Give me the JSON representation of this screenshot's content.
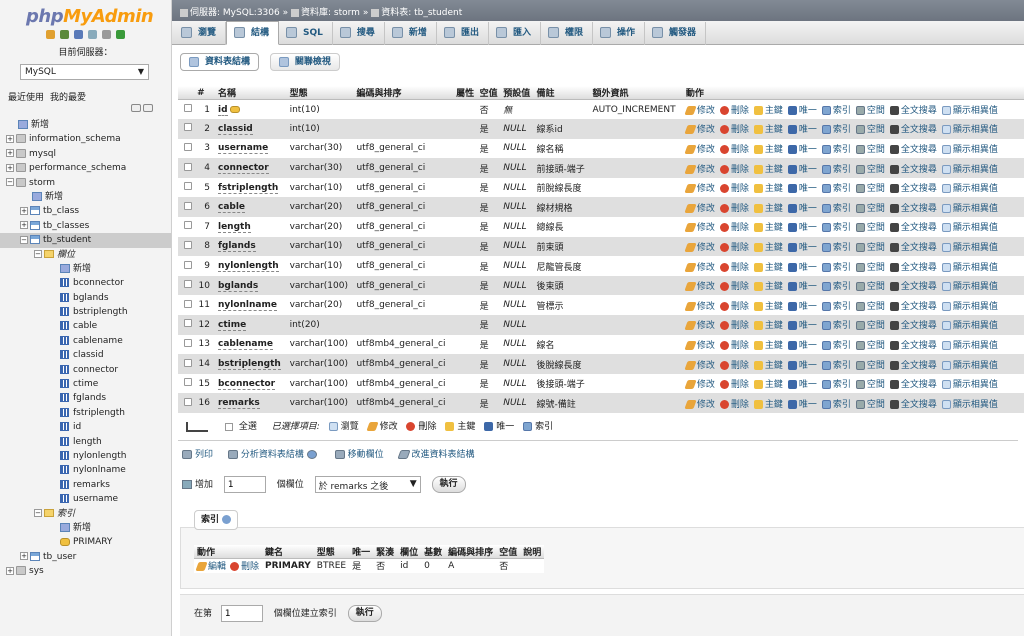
{
  "left": {
    "logo_part1": "php",
    "logo_part2": "MyAdmin",
    "server_label": "目前伺服器：",
    "server_value": "MySQL",
    "recent": "最近使用",
    "favorites": "我的最愛",
    "tree": [
      {
        "label": "新增",
        "kind": "new",
        "indent": 0
      },
      {
        "label": "information_schema",
        "kind": "db",
        "indent": 0
      },
      {
        "label": "mysql",
        "kind": "db",
        "indent": 0
      },
      {
        "label": "performance_schema",
        "kind": "db",
        "indent": 0
      },
      {
        "label": "storm",
        "kind": "db",
        "indent": 0,
        "expanded": true
      },
      {
        "label": "新增",
        "kind": "new",
        "indent": 1
      },
      {
        "label": "tb_class",
        "kind": "table",
        "indent": 1
      },
      {
        "label": "tb_classes",
        "kind": "table",
        "indent": 1
      },
      {
        "label": "tb_student",
        "kind": "table",
        "indent": 1,
        "expanded": true,
        "selected": true
      },
      {
        "label": "欄位",
        "kind": "folder",
        "indent": 2,
        "italic": true
      },
      {
        "label": "新增",
        "kind": "new",
        "indent": 3
      },
      {
        "label": "bconnector",
        "kind": "col",
        "indent": 3
      },
      {
        "label": "bglands",
        "kind": "col",
        "indent": 3
      },
      {
        "label": "bstriplength",
        "kind": "col",
        "indent": 3
      },
      {
        "label": "cable",
        "kind": "col",
        "indent": 3
      },
      {
        "label": "cablename",
        "kind": "col",
        "indent": 3
      },
      {
        "label": "classid",
        "kind": "col",
        "indent": 3
      },
      {
        "label": "connector",
        "kind": "col",
        "indent": 3
      },
      {
        "label": "ctime",
        "kind": "col",
        "indent": 3
      },
      {
        "label": "fglands",
        "kind": "col",
        "indent": 3
      },
      {
        "label": "fstriplength",
        "kind": "col",
        "indent": 3
      },
      {
        "label": "id",
        "kind": "col",
        "indent": 3
      },
      {
        "label": "length",
        "kind": "col",
        "indent": 3
      },
      {
        "label": "nylonlength",
        "kind": "col",
        "indent": 3
      },
      {
        "label": "nylonlname",
        "kind": "col",
        "indent": 3
      },
      {
        "label": "remarks",
        "kind": "col",
        "indent": 3
      },
      {
        "label": "username",
        "kind": "col",
        "indent": 3
      },
      {
        "label": "索引",
        "kind": "folder",
        "indent": 2,
        "italic": true
      },
      {
        "label": "新增",
        "kind": "new",
        "indent": 3
      },
      {
        "label": "PRIMARY",
        "kind": "key",
        "indent": 3
      },
      {
        "label": "tb_user",
        "kind": "table",
        "indent": 1
      },
      {
        "label": "sys",
        "kind": "db",
        "indent": 0
      }
    ]
  },
  "breadcrumb": {
    "server": "伺服器: MySQL:3306",
    "sep": "»",
    "database": "資料庫: storm",
    "table": "資料表: tb_student"
  },
  "tabs": [
    "瀏覽",
    "結構",
    "SQL",
    "搜尋",
    "新增",
    "匯出",
    "匯入",
    "權限",
    "操作",
    "觸發器"
  ],
  "active_tab": 1,
  "subtabs": [
    "資料表結構",
    "關聯檢視"
  ],
  "columns_header": [
    "#",
    "名稱",
    "型態",
    "編碼與排序",
    "屬性",
    "空值",
    "預設值",
    "備註",
    "額外資訊",
    "動作"
  ],
  "rows": [
    {
      "n": "1",
      "name": "id",
      "pk": true,
      "type": "int(10)",
      "coll": "",
      "nul": "否",
      "def": "無",
      "def_italic": true,
      "comment": "",
      "extra": "AUTO_INCREMENT"
    },
    {
      "n": "2",
      "name": "classid",
      "type": "int(10)",
      "coll": "",
      "nul": "是",
      "def": "NULL",
      "def_italic": true,
      "comment": "線系id",
      "extra": ""
    },
    {
      "n": "3",
      "name": "username",
      "type": "varchar(30)",
      "coll": "utf8_general_ci",
      "nul": "是",
      "def": "NULL",
      "def_italic": true,
      "comment": "線名稱",
      "extra": ""
    },
    {
      "n": "4",
      "name": "connector",
      "type": "varchar(30)",
      "coll": "utf8_general_ci",
      "nul": "是",
      "def": "NULL",
      "def_italic": true,
      "comment": "前接頭-端子",
      "extra": ""
    },
    {
      "n": "5",
      "name": "fstriplength",
      "type": "varchar(10)",
      "coll": "utf8_general_ci",
      "nul": "是",
      "def": "NULL",
      "def_italic": true,
      "comment": "前脫線長度",
      "extra": ""
    },
    {
      "n": "6",
      "name": "cable",
      "type": "varchar(20)",
      "coll": "utf8_general_ci",
      "nul": "是",
      "def": "NULL",
      "def_italic": true,
      "comment": "線材規格",
      "extra": ""
    },
    {
      "n": "7",
      "name": "length",
      "type": "varchar(20)",
      "coll": "utf8_general_ci",
      "nul": "是",
      "def": "NULL",
      "def_italic": true,
      "comment": "總線長",
      "extra": ""
    },
    {
      "n": "8",
      "name": "fglands",
      "type": "varchar(10)",
      "coll": "utf8_general_ci",
      "nul": "是",
      "def": "NULL",
      "def_italic": true,
      "comment": "前束頭",
      "extra": ""
    },
    {
      "n": "9",
      "name": "nylonlength",
      "type": "varchar(10)",
      "coll": "utf8_general_ci",
      "nul": "是",
      "def": "NULL",
      "def_italic": true,
      "comment": "尼龍管長度",
      "extra": ""
    },
    {
      "n": "10",
      "name": "bglands",
      "type": "varchar(100)",
      "coll": "utf8_general_ci",
      "nul": "是",
      "def": "NULL",
      "def_italic": true,
      "comment": "後束頭",
      "extra": ""
    },
    {
      "n": "11",
      "name": "nylonlname",
      "type": "varchar(20)",
      "coll": "utf8_general_ci",
      "nul": "是",
      "def": "NULL",
      "def_italic": true,
      "comment": "管標示",
      "extra": ""
    },
    {
      "n": "12",
      "name": "ctime",
      "type": "int(20)",
      "coll": "",
      "nul": "是",
      "def": "NULL",
      "def_italic": true,
      "comment": "",
      "extra": ""
    },
    {
      "n": "13",
      "name": "cablename",
      "type": "varchar(100)",
      "coll": "utf8mb4_general_ci",
      "nul": "是",
      "def": "NULL",
      "def_italic": true,
      "comment": "線名",
      "extra": ""
    },
    {
      "n": "14",
      "name": "bstriplength",
      "type": "varchar(100)",
      "coll": "utf8mb4_general_ci",
      "nul": "是",
      "def": "NULL",
      "def_italic": true,
      "comment": "後脫線長度",
      "extra": ""
    },
    {
      "n": "15",
      "name": "bconnector",
      "type": "varchar(100)",
      "coll": "utf8mb4_general_ci",
      "nul": "是",
      "def": "NULL",
      "def_italic": true,
      "comment": "後接頭-端子",
      "extra": ""
    },
    {
      "n": "16",
      "name": "remarks",
      "type": "varchar(100)",
      "coll": "utf8mb4_general_ci",
      "nul": "是",
      "def": "NULL",
      "def_italic": true,
      "comment": "線號-備註",
      "extra": ""
    }
  ],
  "row_actions": [
    "修改",
    "刪除",
    "主鍵",
    "唯一",
    "索引",
    "空間",
    "全文搜尋",
    "顯示相異值"
  ],
  "bulk": {
    "check_all": "全選",
    "with_selected": "已選擇項目:",
    "browse": "瀏覽",
    "change": "修改",
    "drop": "刪除",
    "primary": "主鍵",
    "unique": "唯一",
    "index": "索引"
  },
  "links": {
    "print": "列印",
    "propose": "分析資料表結構",
    "move": "移動欄位",
    "improve": "改進資料表結構"
  },
  "add_column": {
    "label": "增加",
    "count": "1",
    "unit": "個欄位",
    "position": "於 remarks 之後",
    "go": "執行"
  },
  "indexes": {
    "legend": "索引",
    "headers": [
      "動作",
      "鍵名",
      "型態",
      "唯一",
      "緊湊",
      "欄位",
      "基數",
      "編碼與排序",
      "空值",
      "說明"
    ],
    "rows": [
      {
        "edit": "編輯",
        "drop": "刪除",
        "key": "PRIMARY",
        "type": "BTREE",
        "unique": "是",
        "packed": "否",
        "column": "id",
        "card": "0",
        "coll": "A",
        "nul": "否",
        "comment": ""
      }
    ]
  },
  "create_index": {
    "prefix": "在第",
    "value": "1",
    "suffix": "個欄位建立索引",
    "go": "執行"
  },
  "colors": {
    "link": "#235a81",
    "logo_blue": "#6c78af",
    "logo_orange": "#f89c0e",
    "header_bg": "#777e89",
    "row_alt": "#dfdfdf"
  }
}
